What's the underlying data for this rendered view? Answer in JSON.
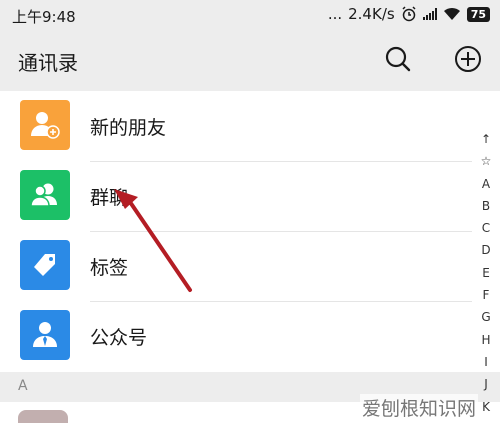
{
  "status_bar": {
    "time": "上午9:48",
    "dots": "...",
    "network_speed": "2.4K/s",
    "battery": "75"
  },
  "header": {
    "title": "通讯录",
    "search_icon": "search-icon",
    "add_icon": "plus-circle-icon"
  },
  "items": [
    {
      "label": "新的朋友",
      "color": "#f9a23b",
      "icon": "add-friend-icon"
    },
    {
      "label": "群聊",
      "color": "#1cc067",
      "icon": "group-icon"
    },
    {
      "label": "标签",
      "color": "#2b8ae6",
      "icon": "tag-icon"
    },
    {
      "label": "公众号",
      "color": "#2b8ae6",
      "icon": "official-account-icon"
    }
  ],
  "section": {
    "letter": "A"
  },
  "index_bar": [
    "↑",
    "☆",
    "A",
    "B",
    "C",
    "D",
    "E",
    "F",
    "G",
    "H",
    "I",
    "J",
    "K"
  ],
  "watermark": "爱刨根知识网",
  "annotation_color": "#b41d24"
}
